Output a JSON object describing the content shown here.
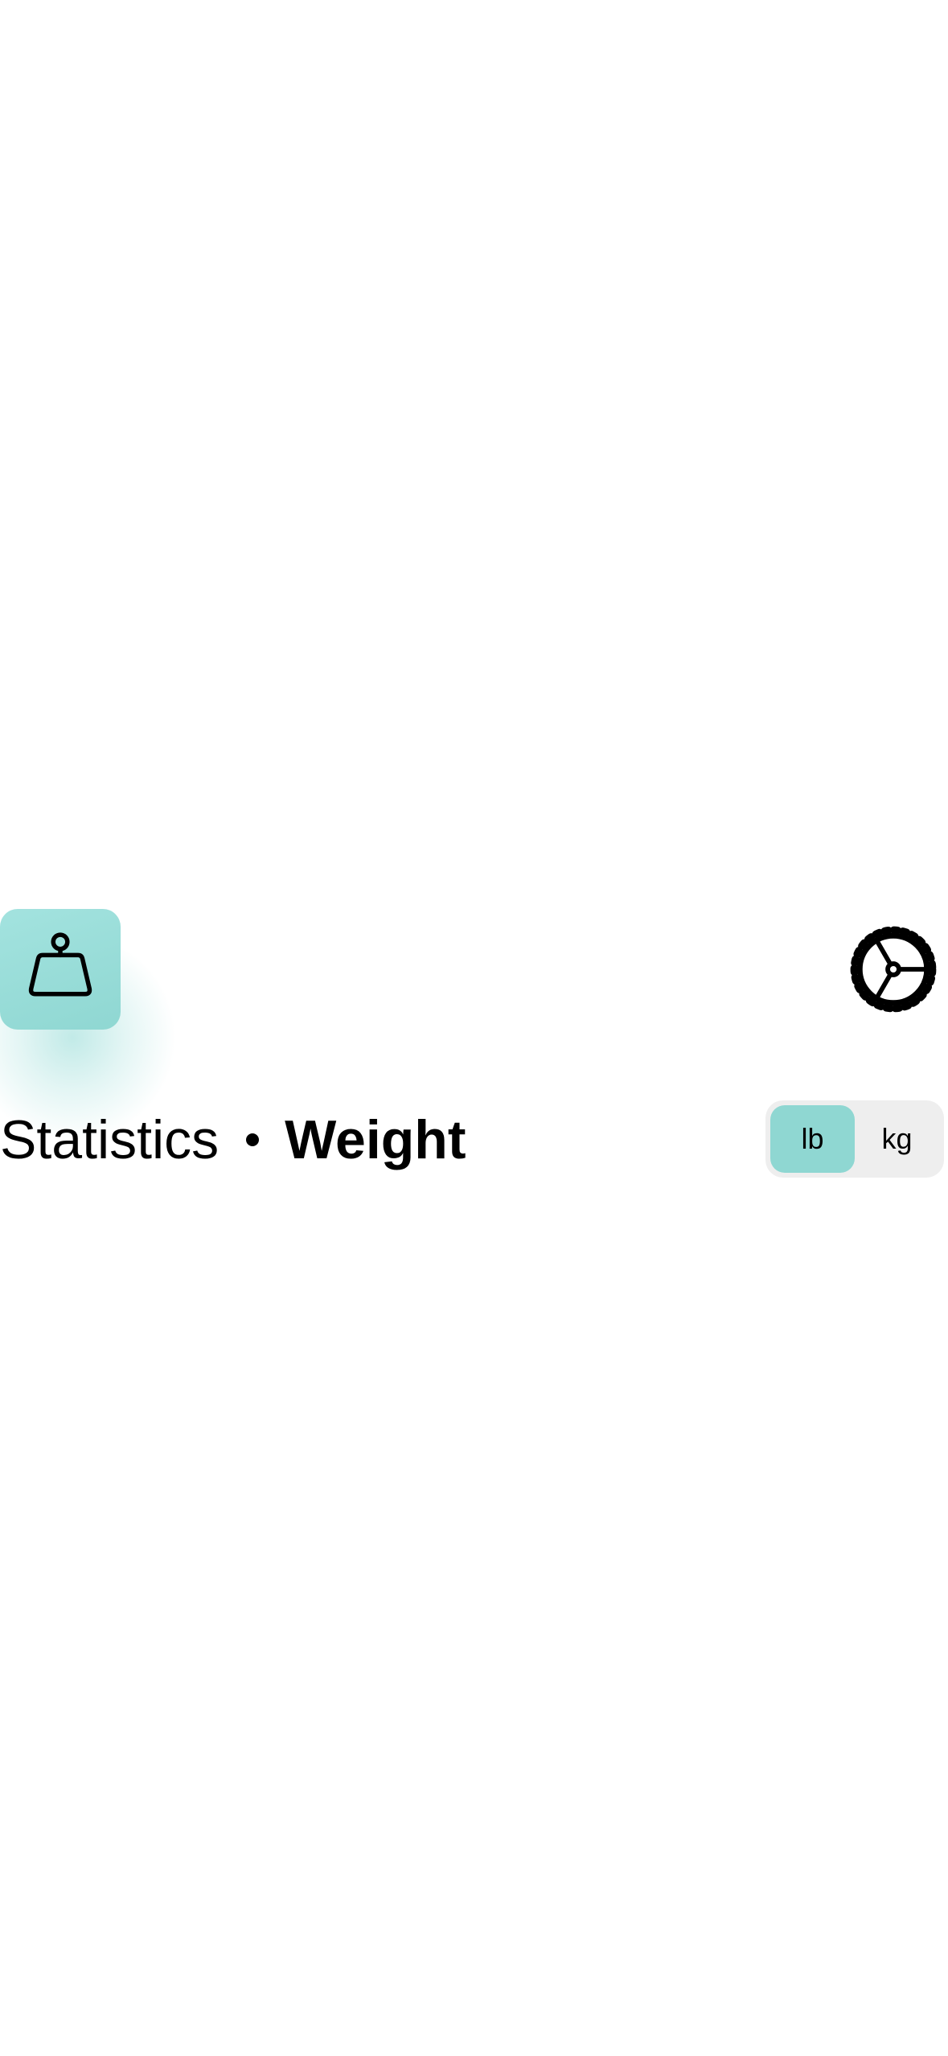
{
  "header": {
    "app_icon": "weight-icon",
    "settings_icon": "gear-icon"
  },
  "title": {
    "section": "Statistics",
    "page": "Weight"
  },
  "unit_toggle": {
    "options": [
      "lb",
      "kg"
    ],
    "selected": "lb"
  },
  "colors": {
    "accent": "#8fd7d2",
    "toggle_bg": "#eeeeee",
    "text": "#000000"
  }
}
